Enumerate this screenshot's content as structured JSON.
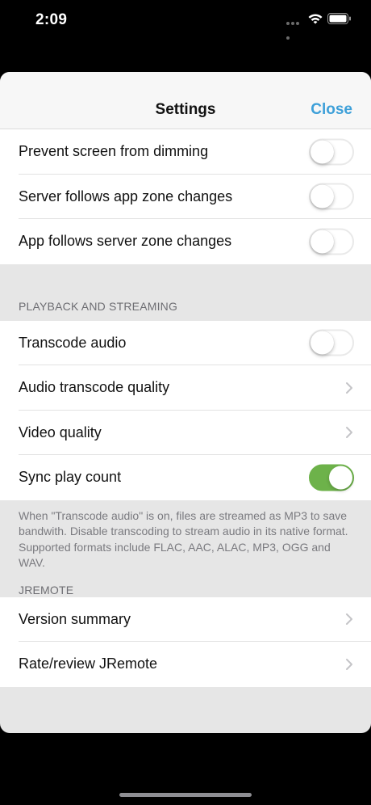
{
  "status_bar": {
    "time": "2:09"
  },
  "nav": {
    "title": "Settings",
    "close_label": "Close"
  },
  "general": {
    "rows": [
      {
        "label": "Prevent screen from dimming",
        "toggle": false
      },
      {
        "label": "Server follows app zone changes",
        "toggle": false
      },
      {
        "label": "App follows server zone changes",
        "toggle": false
      }
    ]
  },
  "playback": {
    "header": "PLAYBACK AND STREAMING",
    "rows": [
      {
        "label": "Transcode audio",
        "toggle": false
      },
      {
        "label": "Audio transcode quality"
      },
      {
        "label": "Video quality"
      },
      {
        "label": "Sync play count",
        "toggle": true
      }
    ],
    "footer": "When \"Transcode audio\" is on, files are streamed as MP3 to save bandwith. Disable transcoding to stream audio in its native format. Supported formats include FLAC, AAC, ALAC, MP3, OGG and WAV."
  },
  "jremote": {
    "header": "JREMOTE",
    "rows": [
      {
        "label": "Version summary"
      },
      {
        "label": "Rate/review JRemote"
      }
    ]
  },
  "colors": {
    "accent": "#3ea0d9",
    "toggle_on": "#6db24a"
  }
}
